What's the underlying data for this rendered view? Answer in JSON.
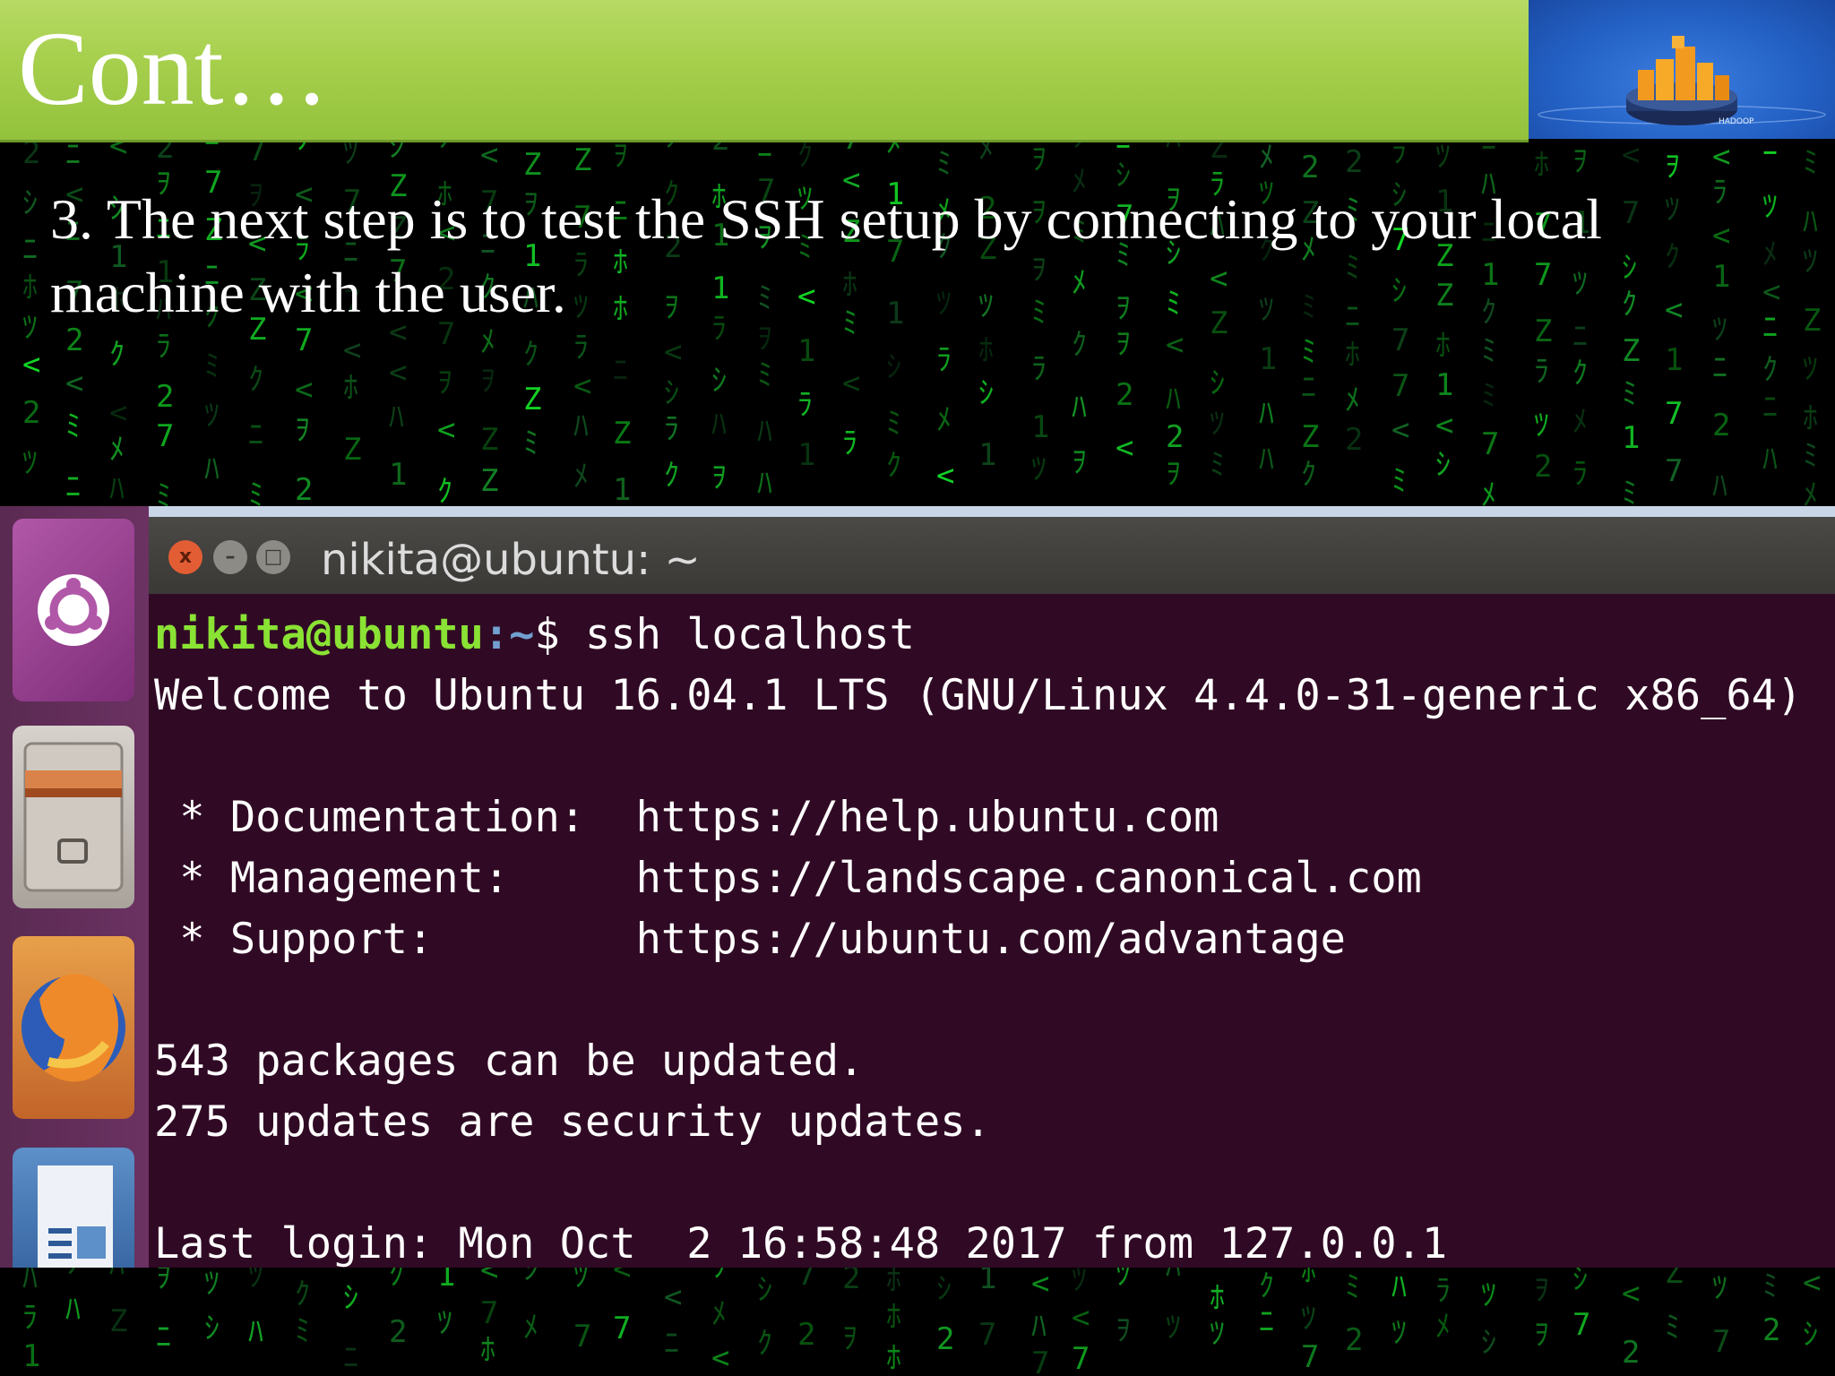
{
  "slide": {
    "title": "Cont…",
    "instruction_line1": "3. The next step is to test the SSH setup by connecting to your local",
    "instruction_line2": "machine with the user."
  },
  "logo": {
    "label": "HADOOP",
    "icon": "hadoop-elephant-logo"
  },
  "launcher": {
    "items": [
      {
        "name": "ubuntu-dash",
        "icon": "ubuntu-icon"
      },
      {
        "name": "files",
        "icon": "file-cabinet-icon"
      },
      {
        "name": "firefox",
        "icon": "firefox-icon"
      },
      {
        "name": "libreoffice-writer",
        "icon": "writer-icon"
      }
    ]
  },
  "terminal": {
    "window_title": "nikita@ubuntu: ~",
    "close_label": "x",
    "min_label": "–",
    "max_label": "□",
    "prompt_user": "nikita@ubuntu",
    "prompt_path": ":~",
    "prompt_symbol": "$ ssh localhost",
    "welcome": "Welcome to Ubuntu 16.04.1 LTS (GNU/Linux 4.4.0-31-generic x86_64)",
    "doc_line": " * Documentation:  https://help.ubuntu.com",
    "mgmt_line": " * Management:     https://landscape.canonical.com",
    "support_line": " * Support:        https://ubuntu.com/advantage",
    "packages_line": "543 packages can be updated.",
    "security_line": "275 updates are security updates.",
    "last_login": "Last login: Mon Oct  2 16:58:48 2017 from 127.0.0.1"
  },
  "colors": {
    "header_green": "#a6cf4c",
    "terminal_bg": "#300a24",
    "prompt_user": "#8ae234",
    "prompt_path": "#729fcf",
    "matrix_green": "#1fbf3a"
  }
}
